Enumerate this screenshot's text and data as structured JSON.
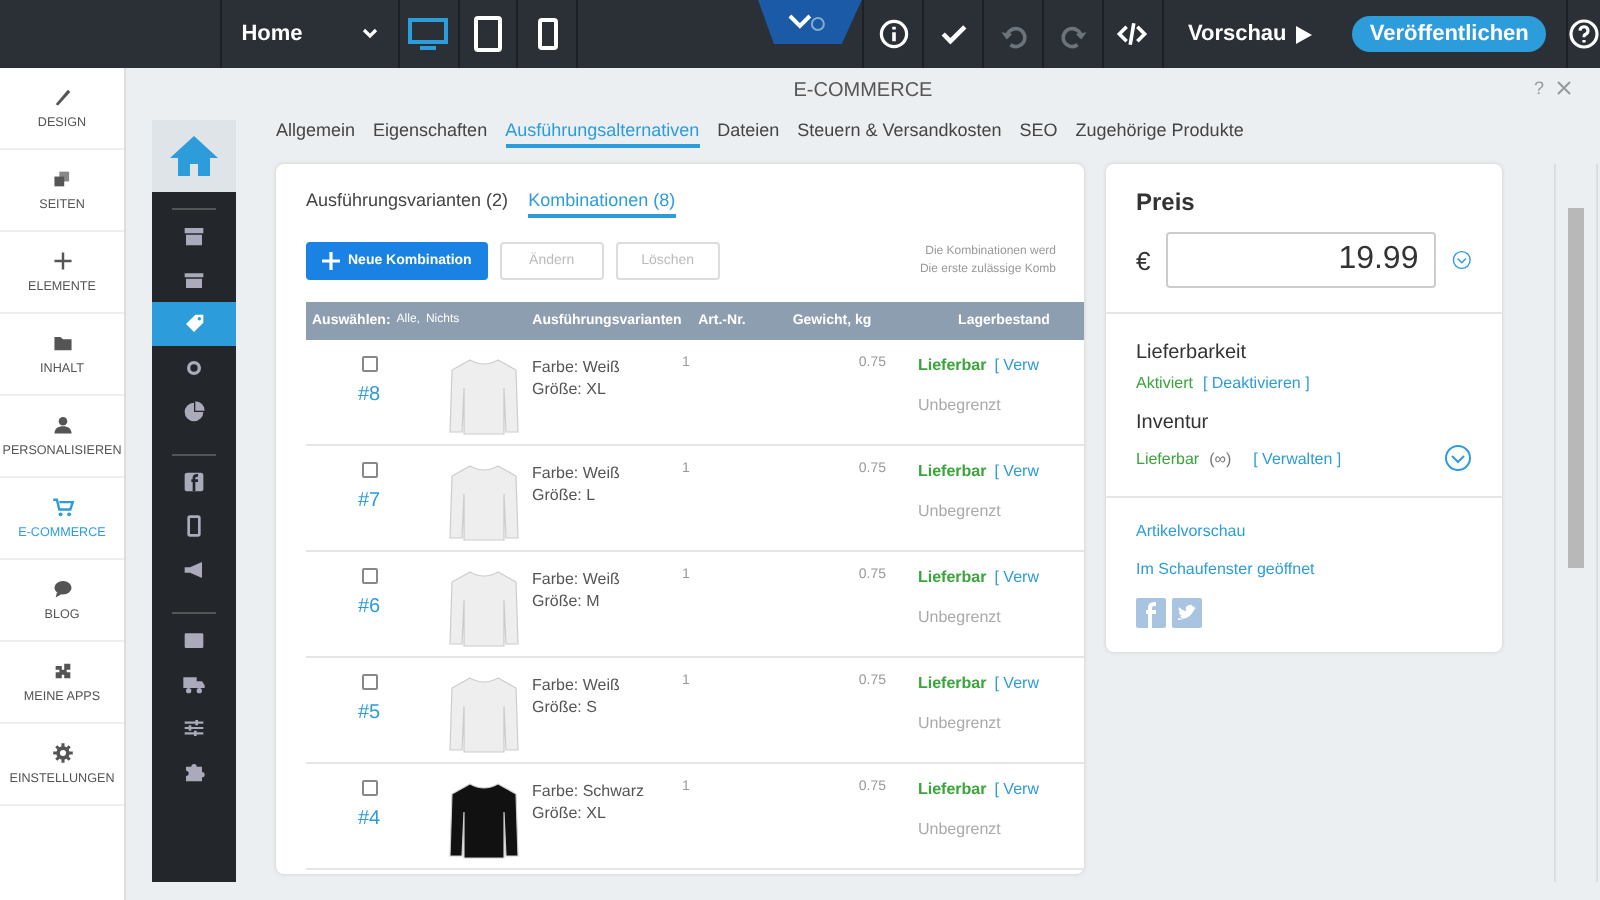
{
  "topbar": {
    "page_select": "Home",
    "devices": [
      {
        "selected": true
      },
      {
        "selected": false
      },
      {
        "selected": false
      }
    ],
    "tools": [
      {
        "disabled": false
      },
      {
        "disabled": false
      },
      {
        "disabled": true
      },
      {
        "disabled": true
      },
      {
        "disabled": false
      }
    ],
    "preview": "Vorschau",
    "publish": "Veröffentlichen"
  },
  "sidebar": {
    "items": [
      {
        "label": "DESIGN",
        "selected": false
      },
      {
        "label": "SEITEN",
        "selected": false
      },
      {
        "label": "ELEMENTE",
        "selected": false
      },
      {
        "label": "INHALT",
        "selected": false
      },
      {
        "label": "PERSONALISIEREN",
        "selected": false
      },
      {
        "label": "E-COMMERCE",
        "selected": true
      },
      {
        "label": "BLOG",
        "selected": false
      },
      {
        "label": "MEINE APPS",
        "selected": false
      },
      {
        "label": "EINSTELLUNGEN",
        "selected": false
      }
    ]
  },
  "dialog": {
    "title": "E-COMMERCE",
    "help": "?",
    "icon_nav": {
      "groups": [
        [
          {
            "selected": false
          },
          {
            "selected": false
          },
          {
            "selected": true
          },
          {
            "selected": false
          },
          {
            "selected": false
          }
        ],
        [
          {
            "selected": false
          },
          {
            "selected": false
          },
          {
            "selected": false
          }
        ],
        [
          {
            "selected": false
          },
          {
            "selected": false
          },
          {
            "selected": false
          },
          {
            "selected": false
          }
        ]
      ]
    },
    "tabs": [
      {
        "label": "Allgemein",
        "selected": false
      },
      {
        "label": "Eigenschaften",
        "selected": false
      },
      {
        "label": "Ausführungsalternativen",
        "selected": true
      },
      {
        "label": "Dateien",
        "selected": false
      },
      {
        "label": "Steuern & Versandkosten",
        "selected": false
      },
      {
        "label": "SEO",
        "selected": false
      },
      {
        "label": "Zugehörige Produkte",
        "selected": false
      }
    ],
    "subtabs": [
      {
        "label": "Ausführungsvarianten (2)",
        "selected": false
      },
      {
        "label": "Kombinationen (8)",
        "selected": true
      }
    ],
    "actions": [
      {
        "label": "Neue Kombination",
        "kind": "primary",
        "disabled": false
      },
      {
        "label": "Ändern",
        "kind": "plain",
        "disabled": true
      },
      {
        "label": "Löschen",
        "kind": "plain",
        "disabled": true
      }
    ],
    "note": [
      "Die Kombinationen werd",
      "Die erste zulässige Komb"
    ],
    "table": {
      "select_label": "Auswählen:",
      "select_all": "Alle,",
      "select_none": "Nichts",
      "columns": [
        "Ausführungsvarianten",
        "Art.-Nr.",
        "Gewicht, kg",
        "Lagerbestand"
      ],
      "rows": [
        {
          "checked": false,
          "number": "#8",
          "color": "#eeeeee",
          "variant": [
            "Farbe: Weiß",
            "Größe: XL"
          ],
          "art_nr": "1",
          "weight": "0.75",
          "status": "Lieferbar",
          "manage": "[ Verw",
          "stock": "Unbegrenzt"
        },
        {
          "checked": false,
          "number": "#7",
          "color": "#eeeeee",
          "variant": [
            "Farbe: Weiß",
            "Größe: L"
          ],
          "art_nr": "1",
          "weight": "0.75",
          "status": "Lieferbar",
          "manage": "[ Verw",
          "stock": "Unbegrenzt"
        },
        {
          "checked": false,
          "number": "#6",
          "color": "#eeeeee",
          "variant": [
            "Farbe: Weiß",
            "Größe: M"
          ],
          "art_nr": "1",
          "weight": "0.75",
          "status": "Lieferbar",
          "manage": "[ Verw",
          "stock": "Unbegrenzt"
        },
        {
          "checked": false,
          "number": "#5",
          "color": "#eeeeee",
          "variant": [
            "Farbe: Weiß",
            "Größe: S"
          ],
          "art_nr": "1",
          "weight": "0.75",
          "status": "Lieferbar",
          "manage": "[ Verw",
          "stock": "Unbegrenzt"
        },
        {
          "checked": false,
          "number": "#4",
          "color": "#111111",
          "variant": [
            "Farbe: Schwarz",
            "Größe: XL"
          ],
          "art_nr": "1",
          "weight": "0.75",
          "status": "Lieferbar",
          "manage": "[ Verw",
          "stock": "Unbegrenzt"
        }
      ]
    },
    "price": {
      "title": "Preis",
      "currency": "€",
      "value": "19.99"
    },
    "availability": {
      "title": "Lieferbarkeit",
      "state": "Aktiviert",
      "action": "[ Deaktivieren ]"
    },
    "inventory": {
      "title": "Inventur",
      "state": "Lieferbar",
      "qty": "(∞)",
      "action": "[ Verwalten ]"
    },
    "links": [
      "Artikelvorschau",
      "Im Schaufenster geöffnet"
    ]
  }
}
